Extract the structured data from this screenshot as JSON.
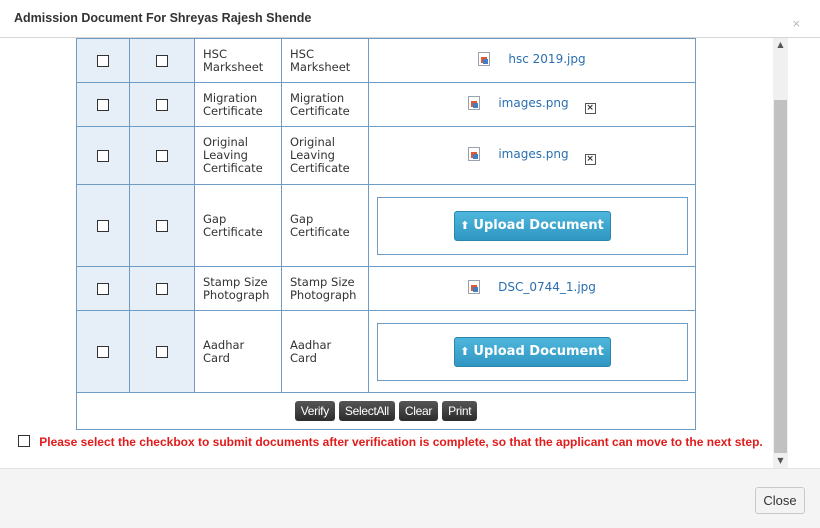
{
  "modal": {
    "title": "Admission Document For Shreyas Rajesh Shende",
    "close_x": "×",
    "close_button": "Close"
  },
  "documents": [
    {
      "name_line1": "HSC",
      "name_line2": "Marksheet",
      "name_line3": "",
      "label_line1": "HSC",
      "label_line2": "Marksheet",
      "label_line3": "",
      "file": "hsc 2019.jpg",
      "deletable": false
    },
    {
      "name_line1": "Migration",
      "name_line2": "Certificate",
      "name_line3": "",
      "label_line1": "Migration",
      "label_line2": "Certificate",
      "label_line3": "",
      "file": "images.png",
      "deletable": true
    },
    {
      "name_line1": "Original",
      "name_line2": "Leaving",
      "name_line3": "Certificate",
      "label_line1": "Original",
      "label_line2": "Leaving",
      "label_line3": "Certificate",
      "file": "images.png",
      "deletable": true
    },
    {
      "name_line1": "Gap",
      "name_line2": "Certificate",
      "name_line3": "",
      "label_line1": "Gap",
      "label_line2": "Certificate",
      "label_line3": "",
      "upload_label": "Upload Document"
    },
    {
      "name_line1": "Stamp Size",
      "name_line2": "Photograph",
      "name_line3": "",
      "label_line1": "Stamp Size",
      "label_line2": "Photograph",
      "label_line3": "",
      "file": "DSC_0744_1.jpg",
      "deletable": false
    },
    {
      "name_line1": "Aadhar",
      "name_line2": "Card",
      "name_line3": "",
      "label_line1": "Aadhar",
      "label_line2": "Card",
      "label_line3": "",
      "upload_label": "Upload Document"
    }
  ],
  "actions": {
    "verify": "Verify",
    "select_all": "SelectAll",
    "clear": "Clear",
    "print": "Print"
  },
  "notice": {
    "text": "Please select the checkbox to submit documents after verification is complete, so that the applicant can move to the next step.",
    "color": "#e11b1b"
  },
  "icons": {
    "file": "image-file-icon",
    "delete": "delete-x-icon",
    "upload": "upload-icon",
    "scroll_up": "chevron-up-icon",
    "scroll_down": "chevron-down-icon"
  },
  "colors": {
    "table_border": "#6f9cc4",
    "checkbox_column_bg": "#e6eff8",
    "upload_button": "#3ba4cc",
    "link": "#2a6fb0"
  }
}
